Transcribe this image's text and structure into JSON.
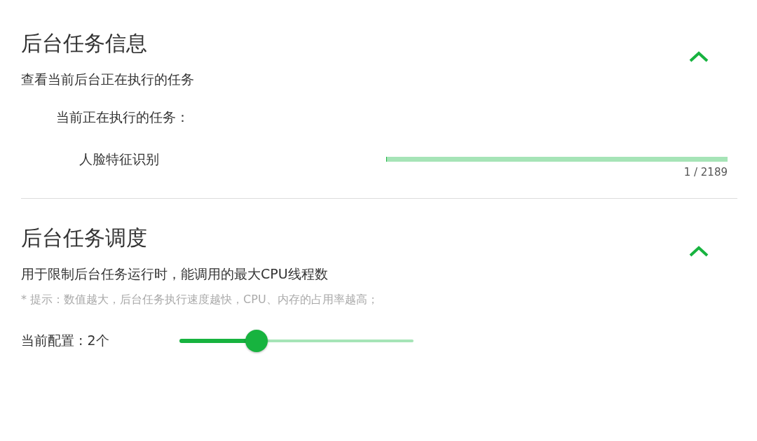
{
  "sections": [
    {
      "title": "后台任务信息",
      "expanded": true,
      "description": "查看当前后台正在执行的任务",
      "kind": "tasks",
      "tasks_heading": "当前正在执行的任务：",
      "tasks": [
        {
          "name": "人脸特征识别",
          "level": 0.0005,
          "progress_text": "1 / 2189"
        }
      ]
    },
    {
      "title": "后台任务调度",
      "expanded": true,
      "description": "用于限制后台任务运行时，能调用的最大CPU线程数",
      "kind": "slider",
      "hint": "* 提示：数值越大，后台任务执行速度越快，CPU、内存的占用率越高；",
      "setting_label": "当前配置 : 2个",
      "level": 0.33
    }
  ]
}
